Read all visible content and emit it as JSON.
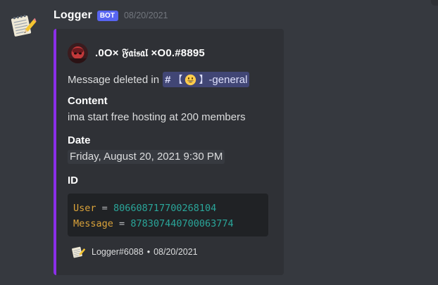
{
  "message": {
    "username": "Logger",
    "bot_tag": "BOT",
    "timestamp": "08/20/2021",
    "avatar_icon": "notepad-pencil-icon"
  },
  "embed": {
    "accent_color": "#8b2fe8",
    "author": {
      "name": ".0O× 𝔉𝔞𝔦𝔰𝔞𝔩 ×O0.#8895",
      "avatar_icon": "user-avatar-photo"
    },
    "description": {
      "prefix": "Message deleted in",
      "channel_hash": "#",
      "channel_open_bracket": "【",
      "channel_emoji": "grinning-face-emoji",
      "channel_close_bracket": "】",
      "channel_suffix": "-general"
    },
    "fields": {
      "content_label": "Content",
      "content_value": "ima start free hosting at 200 members",
      "date_label": "Date",
      "date_value": "Friday, August 20, 2021 9:30 PM",
      "id_label": "ID"
    },
    "code": {
      "user_key": "User",
      "user_value": "806608717700268104",
      "message_key": "Message",
      "message_value": "878307440700063774",
      "equals": "="
    },
    "footer": {
      "text": "Logger#6088",
      "separator": "•",
      "date": "08/20/2021",
      "icon": "notepad-pencil-icon"
    }
  },
  "colors": {
    "background": "#36393f",
    "embed_bg": "#2f3136",
    "bot_tag": "#5865f2",
    "mention_bg": "#414675",
    "code_key": "#dba33a",
    "code_number": "#2aa69a"
  }
}
